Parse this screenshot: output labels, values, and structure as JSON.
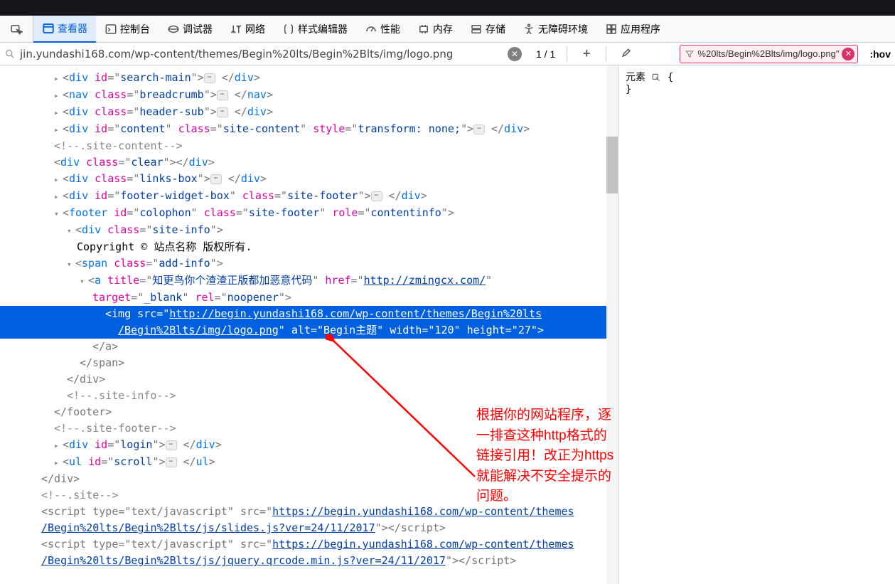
{
  "toolbar": {
    "inspector": "查看器",
    "console": "控制台",
    "debugger": "调试器",
    "network": "网络",
    "style_editor": "样式编辑器",
    "performance": "性能",
    "memory": "内存",
    "storage": "存储",
    "accessibility": "无障碍环境",
    "application": "应用程序"
  },
  "search": {
    "value": "jin.yundashi168.com/wp-content/themes/Begin%20lts/Begin%2Blts/img/logo.png",
    "page_current": "1",
    "page_total": "1"
  },
  "filter": {
    "text": "%20lts/Begin%2Blts/img/logo.png\""
  },
  "hov": ":hov",
  "rules": {
    "label": "元素",
    "braces_open": "{",
    "braces_close": "}"
  },
  "dom": {
    "l01": {
      "tag": "div",
      "attrs": "id=\"search-main\""
    },
    "l02": {
      "tag": "nav",
      "attrs": "class=\"breadcrumb\""
    },
    "l03": {
      "tag": "div",
      "attrs": "class=\"header-sub\""
    },
    "l04_tag": "div",
    "l04_a1n": "id",
    "l04_a1v": "content",
    "l04_a2n": "class",
    "l04_a2v": "site-content",
    "l04_a3n": "style",
    "l04_a3v": "transform: none;",
    "l05": "<!--.site-content-->",
    "l06": {
      "tag": "div",
      "attrs": "class=\"clear\""
    },
    "l07": {
      "tag": "div",
      "attrs": "class=\"links-box\""
    },
    "l08_tag": "div",
    "l08_a1n": "id",
    "l08_a1v": "footer-widget-box",
    "l08_a2n": "class",
    "l08_a2v": "site-footer",
    "l09_tag": "footer",
    "l09_a1n": "id",
    "l09_a1v": "colophon",
    "l09_a2n": "class",
    "l09_a2v": "site-footer",
    "l09_a3n": "role",
    "l09_a3v": "contentinfo",
    "l10": {
      "tag": "div",
      "attrs": "class=\"site-info\""
    },
    "l11": "Copyright ©  站点名称  版权所有.",
    "l12": {
      "tag": "span",
      "attrs": "class=\"add-info\""
    },
    "l13_tag": "a",
    "l13_a1n": "title",
    "l13_a1v": "知更鸟你个渣渣正版都加恶意代码",
    "l13_a2n": "href",
    "l13_a2v": "http://zmingcx.com/",
    "l13_a3n": "target",
    "l13_a3v": "_blank",
    "l13_a4n": "rel",
    "l13_a4v": "noopener",
    "l14_p1": "<img src=\"",
    "l14_url": "http://begin.yundashi168.com/wp-content/themes/Begin%20lts",
    "l14_p2": "/Begin%2Blts/img/logo.png",
    "l14_p3": "\" alt=\"Begin主题\" width=\"120\" height=\"27\">",
    "l15": "</a>",
    "l16": "</span>",
    "l17": "</div>",
    "l18": "<!--.site-info-->",
    "l19": "</footer>",
    "l20": "<!--.site-footer-->",
    "l21": {
      "tag": "div",
      "attrs": "id=\"login\""
    },
    "l22": {
      "tag": "ul",
      "attrs": "id=\"scroll\""
    },
    "l23": "</div>",
    "l24": "<!--.site-->",
    "l25_p1": "<script type=\"text/javascript\" src=\"",
    "l25_url1": "https://begin.yundashi168.com/wp-content/themes",
    "l25_url2": "/Begin%20lts/Begin%2Blts/js/slides.js?ver=24/11/2017",
    "l25_p2": "\"></script>",
    "l26_p1": "<script type=\"text/javascript\" src=\"",
    "l26_url1": "https://begin.yundashi168.com/wp-content/themes",
    "l26_url2": "/Begin%20lts/Begin%2Blts/js/jquery.qrcode.min.js?ver=24/11/2017",
    "l26_p2": "\"></script>"
  },
  "annotation": "根据你的网站程序，逐一排查这种http格式的链接引用！改正为https就能解决不安全提示的问题。"
}
